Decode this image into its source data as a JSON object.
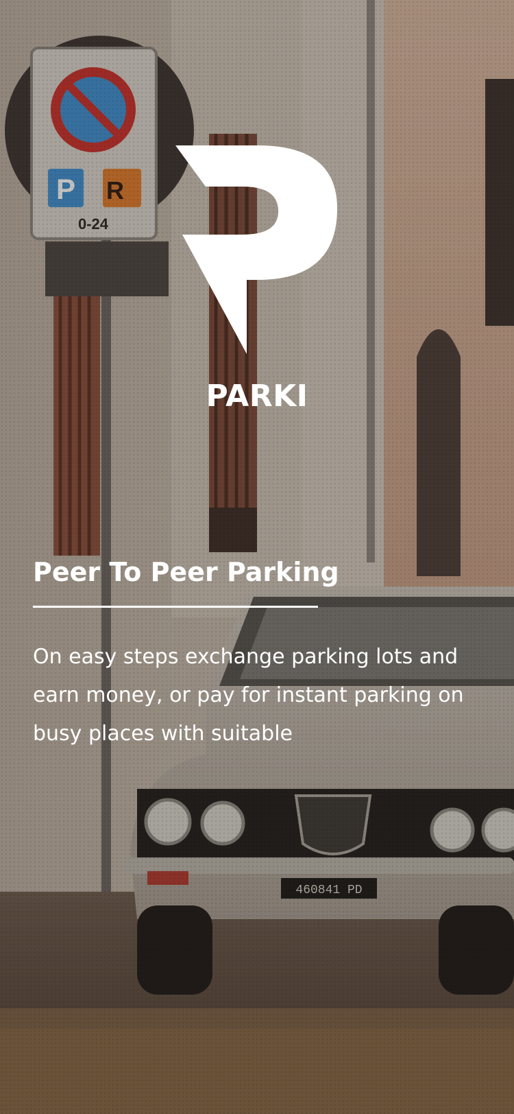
{
  "brand": {
    "logo_icon": "parki-p-logo-icon",
    "name": "PARKI"
  },
  "onboarding": {
    "title": "Peer To Peer Parking",
    "description": "On easy steps exchange parking lots and earn money, or pay for instant parking on busy places with suitable"
  },
  "background": {
    "image": "vintage-car-parked-street-photo",
    "elements": [
      "no-parking-sign",
      "parking-hours-plate",
      "classic-car",
      "building-wall",
      "barred-windows",
      "arched-doorway"
    ],
    "sign_text": {
      "p_badge": "P",
      "r_badge": "R",
      "hours": "0-24"
    },
    "plate_text": "460841 PD"
  },
  "colors": {
    "text": "#ffffff",
    "overlay": "#2a221e",
    "sign_red": "#c9302a",
    "sign_blue": "#3e8fd0",
    "sign_orange": "#e07a2a"
  }
}
